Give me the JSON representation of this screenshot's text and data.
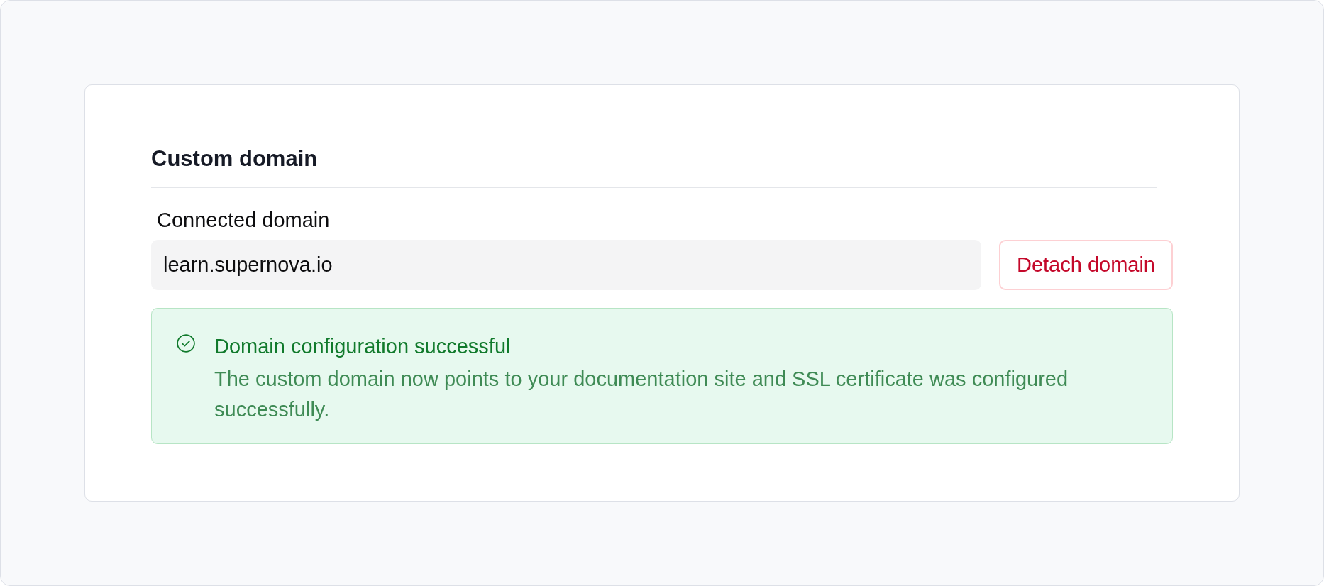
{
  "section": {
    "title": "Custom domain"
  },
  "domain_field": {
    "label": "Connected domain",
    "value": "learn.supernova.io"
  },
  "detach_button": {
    "label": "Detach domain"
  },
  "alert": {
    "kind": "success",
    "title": "Domain configuration successful",
    "message": "The custom domain now points to your documentation site and SSL certificate was configured successfully."
  }
}
